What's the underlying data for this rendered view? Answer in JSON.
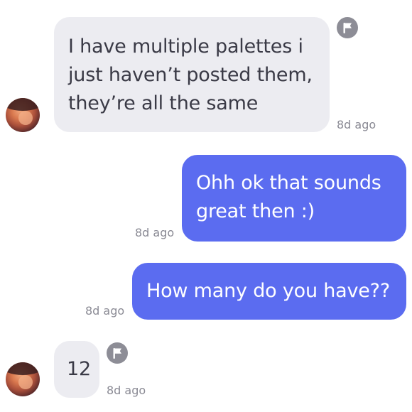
{
  "messages": [
    {
      "direction": "incoming",
      "text": "I have multiple palettes i\njust haven’t posted them,\nthey’re all the same",
      "time": "8d ago"
    },
    {
      "direction": "outgoing",
      "text": "Ohh ok that sounds\ngreat then :)",
      "time": "8d ago"
    },
    {
      "direction": "outgoing",
      "text": "How many do you have??",
      "time": "8d ago"
    },
    {
      "direction": "incoming",
      "text": "12",
      "time": "8d ago"
    }
  ],
  "icons": {
    "report": "flag-icon",
    "avatar": "contact-avatar"
  },
  "colors": {
    "incoming_bubble": "#ececf1",
    "outgoing_bubble": "#5b6cf0",
    "timestamp": "#8a8a94",
    "flag": "#8d8d96"
  }
}
